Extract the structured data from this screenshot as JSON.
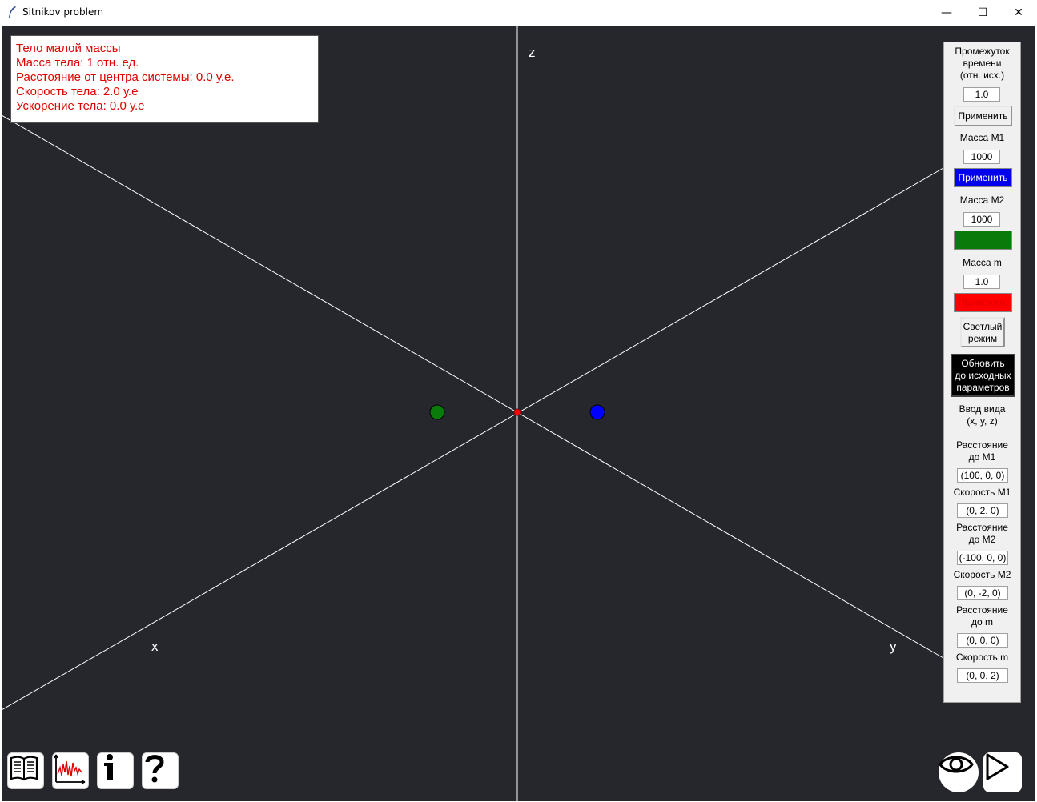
{
  "window": {
    "title": "Sitnikov problem",
    "minimize_icon": "—",
    "maximize_icon": "☐",
    "close_icon": "✕"
  },
  "info": {
    "line1": "Тело малой массы",
    "line2": "Масса тела: 1 отн. ед.",
    "line3": "Расстояние от центра системы: 0.0 у.е.",
    "line4": "Скорость тела: 2.0 у.е",
    "line5": "Ускорение тела: 0.0 у.е"
  },
  "axes": {
    "x": "x",
    "y": "y",
    "z": "z"
  },
  "bodies": [
    {
      "name": "M2",
      "color": "#0a7a0a"
    },
    {
      "name": "m",
      "color": "#ff0000"
    },
    {
      "name": "M1",
      "color": "#0000ff"
    }
  ],
  "panel": {
    "time_label_1": "Промежуток",
    "time_label_2": "времени",
    "time_label_3": "(отн. исх.)",
    "time_value": "1.0",
    "apply": "Применить",
    "mass_m1_label": "Масса М1",
    "mass_m1_value": "1000",
    "mass_m2_label": "Масса М2",
    "mass_m2_value": "1000",
    "mass_m_label": "Масса m",
    "mass_m_value": "1.0",
    "light_mode_1": "Светлый",
    "light_mode_2": "режим",
    "reset_1": "Обновить",
    "reset_2": "до исходных",
    "reset_3": "параметров",
    "view_input_1": "Ввод вида",
    "view_input_2": "(x, y, z)",
    "dist_m1_1": "Расстояние",
    "dist_m1_2": "до М1",
    "dist_m1_value": "(100, 0, 0)",
    "vel_m1_label": "Скорость М1",
    "vel_m1_value": "(0, 2, 0)",
    "dist_m2_1": "Расстояние",
    "dist_m2_2": "до М2",
    "dist_m2_value": "(-100, 0, 0)",
    "vel_m2_label": "Скорость М2",
    "vel_m2_value": "(0, -2, 0)",
    "dist_m_1": "Расстояние",
    "dist_m_2": "до m",
    "dist_m_value": "(0, 0, 0)",
    "vel_m_label": "Скорость m",
    "vel_m_value": "(0, 0, 2)"
  },
  "colors": {
    "background": "#25272d",
    "info_text": "#e00000",
    "axis_lines": "#ffffff"
  },
  "tools": [
    "book-icon",
    "chart-icon",
    "info-icon",
    "help-icon",
    "eye-icon",
    "play-icon"
  ]
}
